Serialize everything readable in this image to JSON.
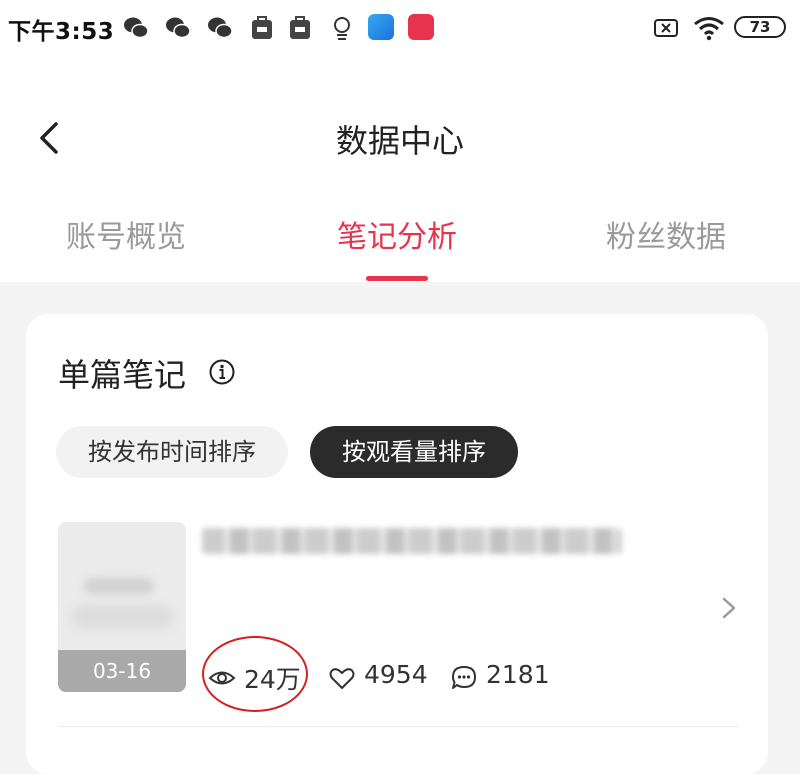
{
  "status_bar": {
    "time": "下午3:53",
    "battery": "73",
    "icons": [
      "wechat-icon",
      "wechat-icon",
      "wechat-icon",
      "mi-store-icon",
      "mi-store-icon",
      "bulb-icon",
      "blue-app-icon",
      "xiaohongshu-icon",
      "screen-off-icon",
      "wifi-icon",
      "battery-icon"
    ]
  },
  "header": {
    "title": "数据中心"
  },
  "tabs": [
    {
      "label": "账号概览",
      "active": false
    },
    {
      "label": "笔记分析",
      "active": true
    },
    {
      "label": "粉丝数据",
      "active": false
    }
  ],
  "card": {
    "section_title": "单篇笔记",
    "sort_buttons": [
      {
        "label": "按发布时间排序",
        "selected": false
      },
      {
        "label": "按观看量排序",
        "selected": true
      }
    ],
    "note": {
      "date": "03-16",
      "views": "24万",
      "likes": "4954",
      "comments": "2181"
    }
  },
  "colors": {
    "accent": "#e8334f",
    "selected_pill": "#2b2b2b",
    "highlight_ring": "#d42020"
  }
}
